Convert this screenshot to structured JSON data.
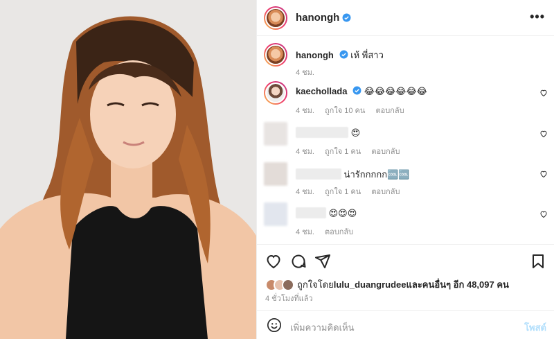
{
  "post": {
    "username": "hanongh",
    "more_label": "•••"
  },
  "caption": {
    "username": "hanongh",
    "text": "เห้ พี่สาว",
    "time": "4 ชม."
  },
  "comments": [
    {
      "username": "kaechollada",
      "verified": true,
      "text": "😂😂😂😂😂😂",
      "time": "4 ชม.",
      "likes": "ถูกใจ 10 คน",
      "reply": "ตอบกลับ"
    },
    {
      "username": "",
      "verified": false,
      "text": "😍",
      "time": "4 ชม.",
      "likes": "ถูกใจ 1 คน",
      "reply": "ตอบกลับ"
    },
    {
      "username": "",
      "verified": false,
      "text": "น่ารักกกกก🆒🆒",
      "time": "4 ชม.",
      "likes": "ถูกใจ 1 คน",
      "reply": "ตอบกลับ"
    },
    {
      "username": "",
      "verified": false,
      "text": "😍😍😍",
      "time": "4 ชม.",
      "likes": "",
      "reply": "ตอบกลับ"
    }
  ],
  "likes": {
    "prefix": "ถูกใจโดย ",
    "user": "lulu_duangrudee",
    "suffix": " และคนอื่นๆ อีก 48,097 คน"
  },
  "time_ago": "4 ชั่วโมงที่แล้ว",
  "add_comment": {
    "placeholder": "เพิ่มความคิดเห็น",
    "post_label": "โพสต์"
  },
  "colors": {
    "verified": "#3897f0",
    "muted": "#8e8e8e",
    "post_button": "#b2dffc"
  }
}
